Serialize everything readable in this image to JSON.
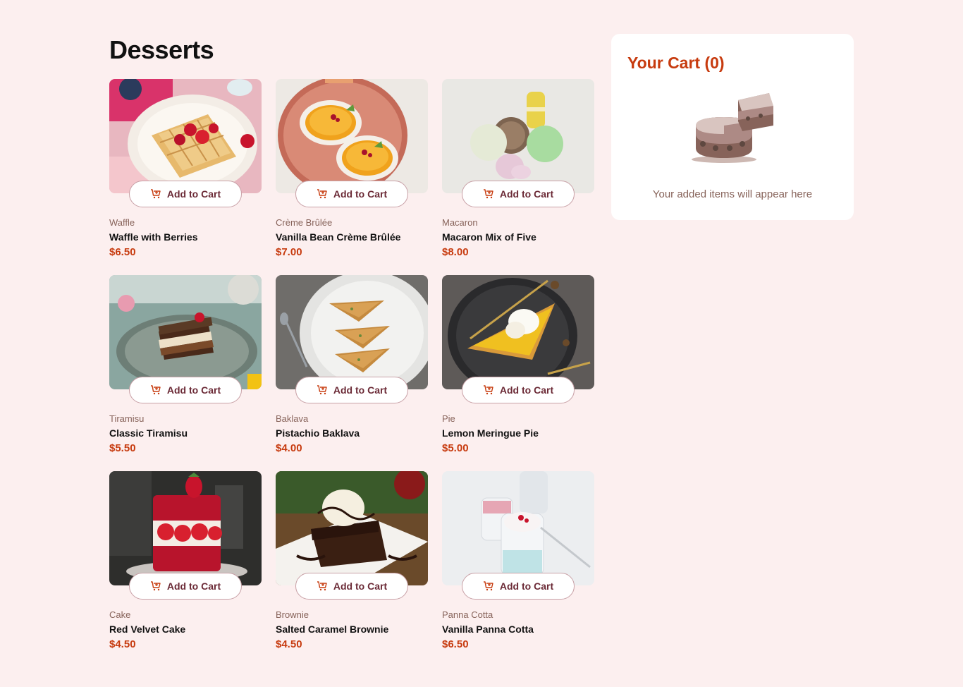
{
  "page_title": "Desserts",
  "add_to_cart_label": "Add to Cart",
  "products": [
    {
      "category": "Waffle",
      "name": "Waffle with Berries",
      "price": "$6.50",
      "image_icon": "waffle-image"
    },
    {
      "category": "Crème Brûlée",
      "name": "Vanilla Bean Crème Brûlée",
      "price": "$7.00",
      "image_icon": "creme-brulee-image"
    },
    {
      "category": "Macaron",
      "name": "Macaron Mix of Five",
      "price": "$8.00",
      "image_icon": "macaron-image"
    },
    {
      "category": "Tiramisu",
      "name": "Classic Tiramisu",
      "price": "$5.50",
      "image_icon": "tiramisu-image"
    },
    {
      "category": "Baklava",
      "name": "Pistachio Baklava",
      "price": "$4.00",
      "image_icon": "baklava-image"
    },
    {
      "category": "Pie",
      "name": "Lemon Meringue Pie",
      "price": "$5.00",
      "image_icon": "pie-image"
    },
    {
      "category": "Cake",
      "name": "Red Velvet Cake",
      "price": "$4.50",
      "image_icon": "cake-image"
    },
    {
      "category": "Brownie",
      "name": "Salted Caramel Brownie",
      "price": "$4.50",
      "image_icon": "brownie-image"
    },
    {
      "category": "Panna Cotta",
      "name": "Vanilla Panna Cotta",
      "price": "$6.50",
      "image_icon": "panna-cotta-image"
    }
  ],
  "cart": {
    "title": "Your Cart (0)",
    "empty_message": "Your added items will appear here",
    "illustration_icon": "empty-cake-icon"
  },
  "colors": {
    "background": "#fcefef",
    "accent": "#c73b0f",
    "muted": "#87635a",
    "button_border": "#c8a0a6"
  }
}
